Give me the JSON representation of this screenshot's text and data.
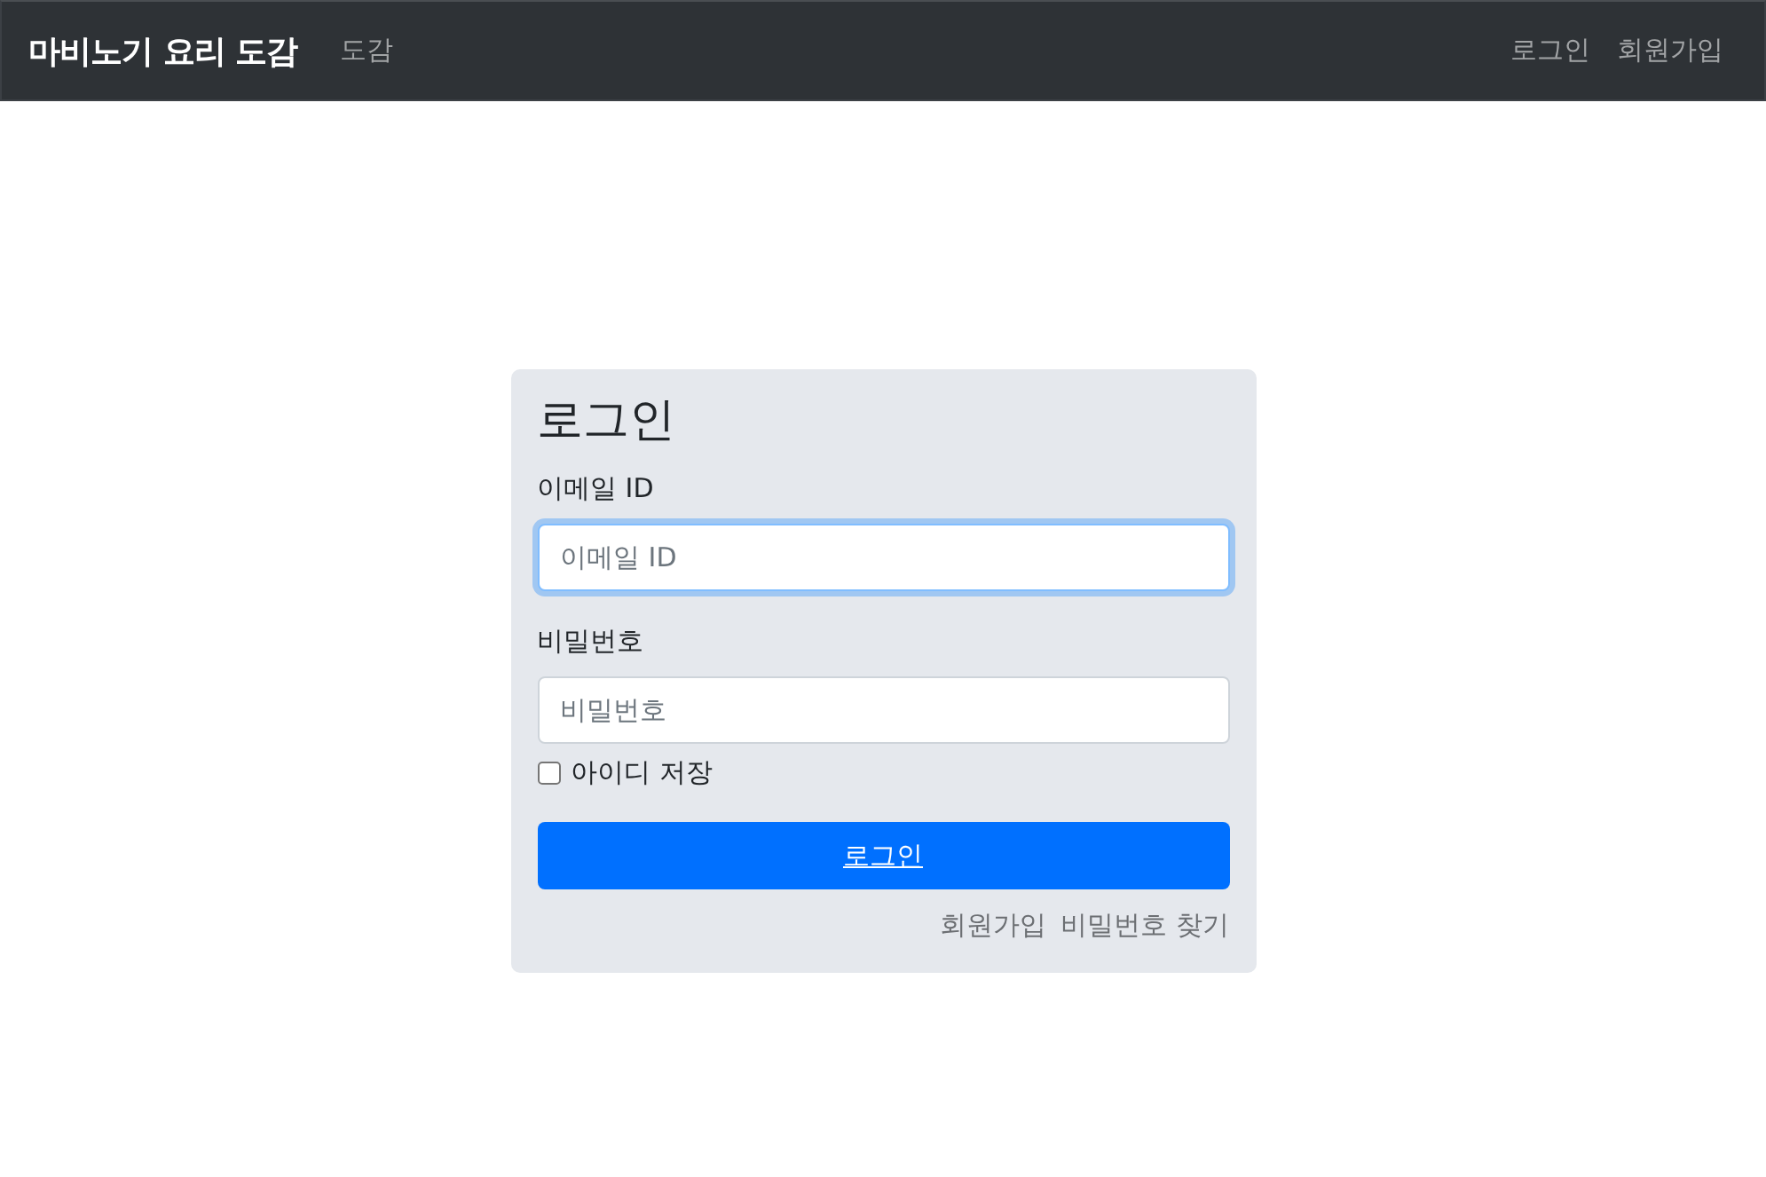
{
  "navbar": {
    "brand": "마비노기 요리 도감",
    "links": [
      {
        "label": "도감"
      }
    ],
    "right_links": [
      {
        "label": "로그인"
      },
      {
        "label": "회원가입"
      }
    ]
  },
  "login_form": {
    "title": "로그인",
    "fields": [
      {
        "label": "이메일 ID",
        "placeholder": "이메일 ID",
        "focused": true
      },
      {
        "label": "비밀번호",
        "placeholder": "비밀번호",
        "focused": false
      }
    ],
    "remember": {
      "label": "아이디 저장",
      "checked": false
    },
    "submit": "로그인",
    "links": [
      "회원가입",
      "비밀번호 찾기"
    ]
  }
}
